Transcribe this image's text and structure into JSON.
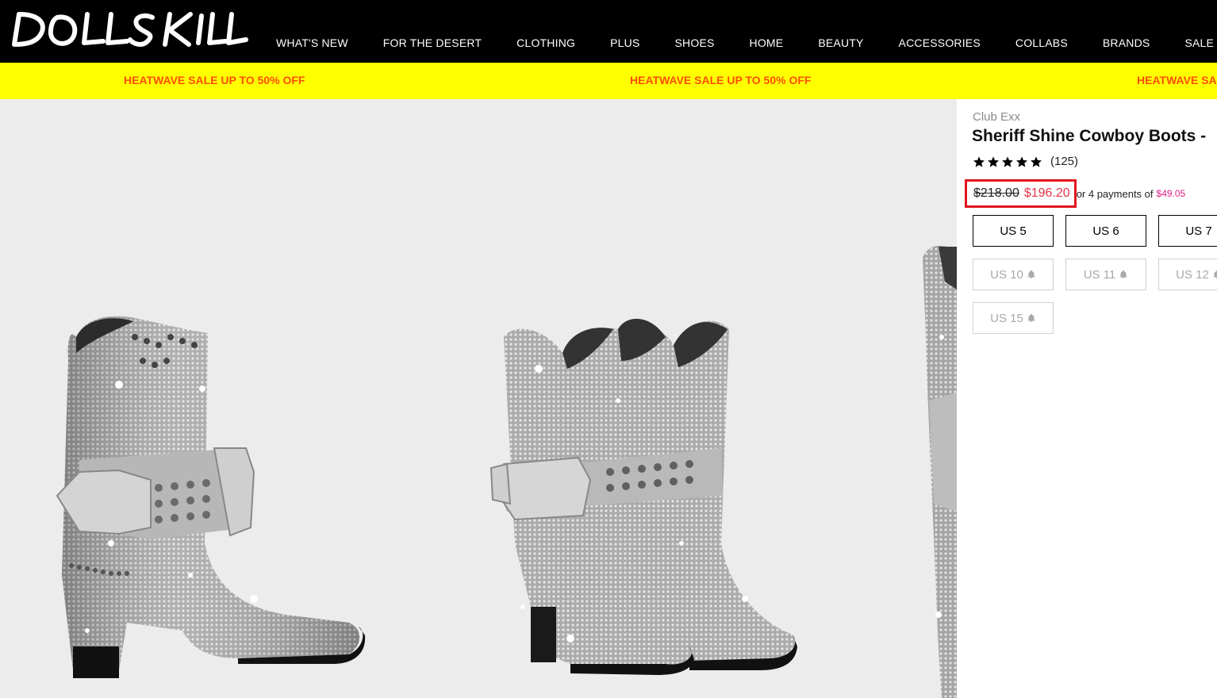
{
  "header": {
    "logo_text": "DOLLS KILL",
    "nav": [
      "WHAT'S NEW",
      "FOR THE DESERT",
      "CLOTHING",
      "PLUS",
      "SHOES",
      "HOME",
      "BEAUTY",
      "ACCESSORIES",
      "COLLABS",
      "BRANDS",
      "SALE"
    ]
  },
  "promo": {
    "text": "HEATWAVE SALE UP TO 50% OFF"
  },
  "product": {
    "brand": "Club Exx",
    "title": "Sheriff Shine Cowboy Boots -",
    "rating": 5,
    "review_count": "(125)",
    "price_original": "$218.00",
    "price_sale": "$196.20",
    "installments_text": "or 4 payments of",
    "installment_amount": "$49.05",
    "sizes": [
      {
        "label": "US 5",
        "available": true
      },
      {
        "label": "US 6",
        "available": true
      },
      {
        "label": "US 7",
        "available": true
      },
      {
        "label": "US 10",
        "available": false
      },
      {
        "label": "US 11",
        "available": false
      },
      {
        "label": "US 12",
        "available": false
      },
      {
        "label": "US 15",
        "available": false
      }
    ]
  },
  "colors": {
    "header_bg": "#000000",
    "promo_bg": "#ffff00",
    "promo_text": "#ff4d00",
    "sale_price": "#e8334a",
    "highlight_box": "#e0161e",
    "installment": "#e0218a",
    "gallery_bg": "#ececec"
  },
  "icons": [
    "star-icon",
    "bell-icon"
  ]
}
